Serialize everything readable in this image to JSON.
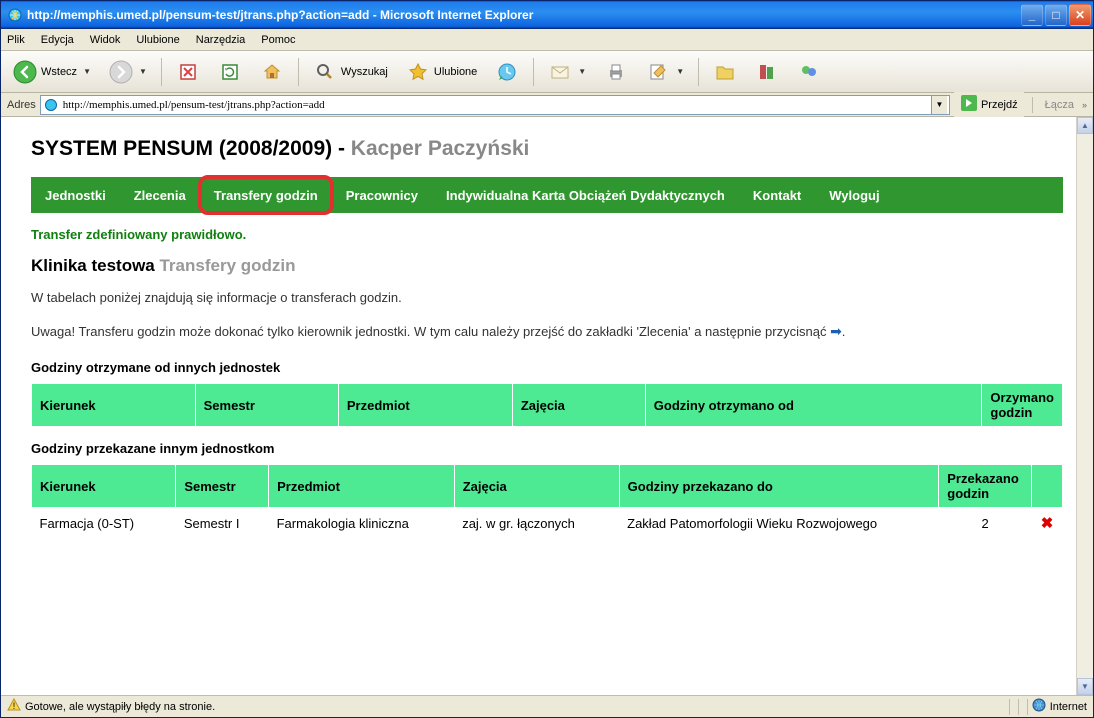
{
  "window_title": "http://memphis.umed.pl/pensum-test/jtrans.php?action=add - Microsoft Internet Explorer",
  "menubar": [
    "Plik",
    "Edycja",
    "Widok",
    "Ulubione",
    "Narzędzia",
    "Pomoc"
  ],
  "toolbar": {
    "back": "Wstecz",
    "search": "Wyszukaj",
    "favorites": "Ulubione"
  },
  "addressbar": {
    "label": "Adres",
    "url": "http://memphis.umed.pl/pensum-test/jtrans.php?action=add",
    "go": "Przejdź",
    "links": "Łącza"
  },
  "page": {
    "system_title": "SYSTEM PENSUM (2008/2009) - ",
    "user_name": "Kacper Paczyński",
    "nav": [
      "Jednostki",
      "Zlecenia",
      "Transfery godzin",
      "Pracownicy",
      "Indywidualna Karta Obciążeń Dydaktycznych",
      "Kontakt",
      "Wyloguj"
    ],
    "status_msg": "Transfer zdefiniowany prawidłowo.",
    "section_title_main": "Klinika testowa ",
    "section_title_sub": "Transfery godzin",
    "info": "W tabelach poniżej znajdują się informacje o transferach godzin.",
    "warning_pre": "Uwaga! Transferu godzin może dokonać tylko kierownik jednostki. W tym calu należy przejść do zakładki 'Zlecenia' a następnie przycisnąć ",
    "warning_post": ".",
    "table1_title": "Godziny otrzymane od innych jednostek",
    "table1_headers": [
      "Kierunek",
      "Semestr",
      "Przedmiot",
      "Zajęcia",
      "Godziny otrzymano od",
      "Orzymano godzin"
    ],
    "table2_title": "Godziny przekazane innym jednostkom",
    "table2_headers": [
      "Kierunek",
      "Semestr",
      "Przedmiot",
      "Zajęcia",
      "Godziny przekazano do",
      "Przekazano godzin",
      ""
    ],
    "table2_rows": [
      {
        "kierunek": "Farmacja (0-ST)",
        "semestr": "Semestr I",
        "przedmiot": "Farmakologia kliniczna",
        "zajecia": "zaj. w gr. łączonych",
        "przekazano_do": "Zakład Patomorfologii Wieku Rozwojowego",
        "godzin": "2"
      }
    ]
  },
  "statusbar": {
    "left": "Gotowe, ale wystąpiły błędy na stronie.",
    "right": "Internet"
  }
}
